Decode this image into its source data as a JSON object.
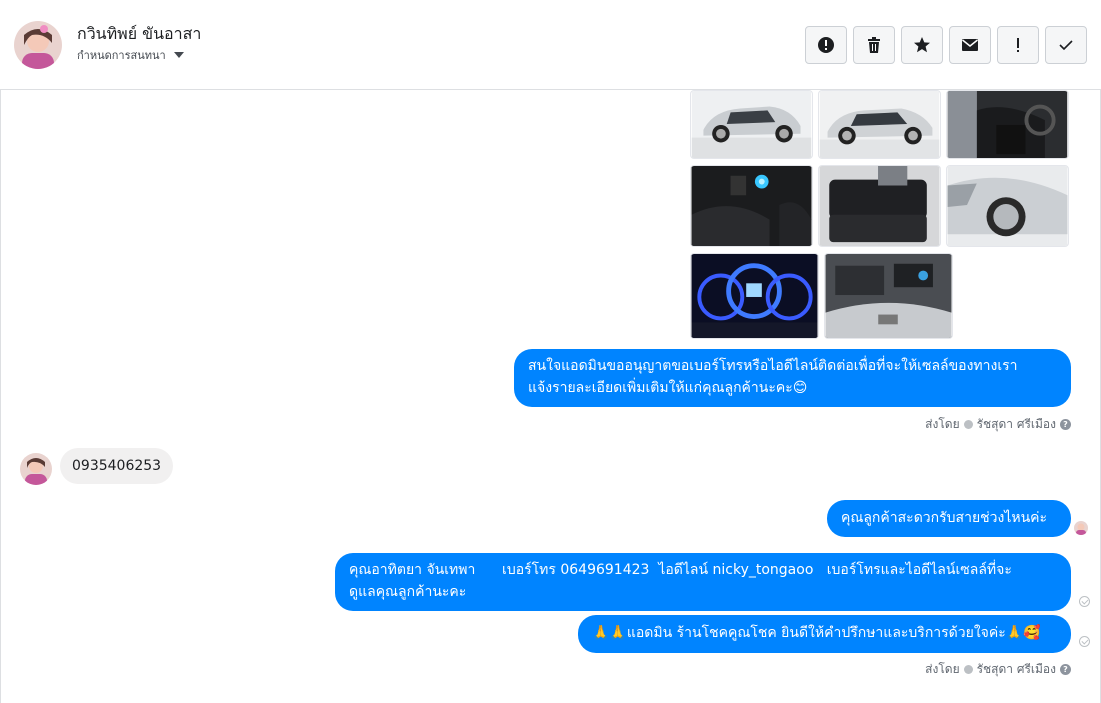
{
  "contact": {
    "name": "กวินทิพย์ ขันอาสา",
    "assign_label": "กำหนดการสนทนา"
  },
  "toolbar": {
    "buttons": [
      {
        "name": "report-spam-button",
        "icon": "alert-circle-icon"
      },
      {
        "name": "delete-button",
        "icon": "trash-icon"
      },
      {
        "name": "star-button",
        "icon": "star-icon"
      },
      {
        "name": "mark-unread-button",
        "icon": "envelope-icon"
      },
      {
        "name": "important-button",
        "icon": "exclamation-icon"
      },
      {
        "name": "mark-done-button",
        "icon": "checkmark-icon"
      }
    ]
  },
  "thread": {
    "photos": [
      {
        "name": "car-photo-exterior-side-1",
        "subject": "car side"
      },
      {
        "name": "car-photo-exterior-side-2",
        "subject": "car side"
      },
      {
        "name": "car-photo-interior-front",
        "subject": "interior"
      },
      {
        "name": "car-photo-gear-console",
        "subject": "interior dark"
      },
      {
        "name": "car-photo-rear-seats",
        "subject": "interior seats"
      },
      {
        "name": "car-photo-front-wheel",
        "subject": "car front"
      },
      {
        "name": "car-photo-dashboard-gauges",
        "subject": "gauges"
      },
      {
        "name": "car-photo-engine-bay",
        "subject": "engine"
      }
    ],
    "messages": [
      {
        "from": "page",
        "text_line1": "สนใจแอดมินขออนุญาตขอเบอร์โทรหรือไอดีไลน์ติดต่อเพื่อที่จะให้เซลล์ของทางเรา",
        "text_line2": "แจ้งรายละเอียดเพิ่มเติมให้แก่คุณลูกค้านะคะ😊"
      },
      {
        "from": "customer",
        "text": "0935406253"
      },
      {
        "from": "page",
        "text": "คุณลูกค้าสะดวกรับสายช่วงไหนค่ะ"
      },
      {
        "from": "page",
        "text_line1": "คุณอาทิตยา จันเทพา      เบอร์โทร 0649691423  ไอดีไลน์ nicky_tongaoo   เบอร์โทรและไอดีไลน์เซลล์ที่จะ",
        "text_line2": "ดูแลคุณลูกค้านะคะ"
      },
      {
        "from": "page",
        "text": "🙏🙏แอดมิน ร้านโชคคูณโชค ยินดีให้คำปรึกษาและบริการด้วยใจค่ะ🙏🥰"
      }
    ],
    "sent_by_1": {
      "prefix": "ส่งโดย",
      "agent": "รัชสุดา ศรีเมือง"
    },
    "sent_by_2": {
      "prefix": "ส่งโดย",
      "agent": "รัชสุดา ศรีเมือง"
    }
  },
  "colors": {
    "bubble_out": "#0084ff",
    "bubble_in": "#f1f0f0",
    "border": "#dddfe2"
  }
}
